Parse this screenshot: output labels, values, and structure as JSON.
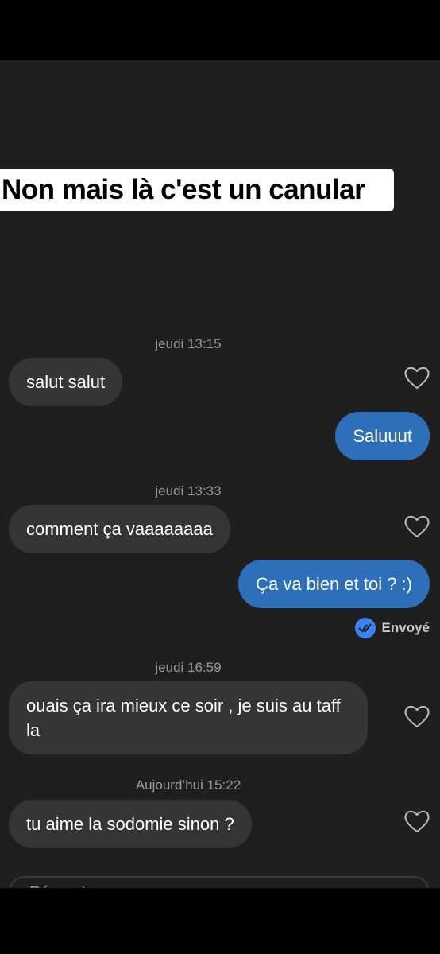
{
  "caption": "Non mais là c'est un canular",
  "messages": [
    {
      "timestamp": "jeudi 13:15"
    },
    {
      "text": "salut salut"
    },
    {
      "text": "Saluuut"
    },
    {
      "timestamp": "jeudi 13:33"
    },
    {
      "text": "comment ça vaaaaaaaa"
    },
    {
      "text": "Ça va bien et toi ? :)"
    },
    {
      "timestamp": "jeudi 16:59"
    },
    {
      "text": "ouais ça ira mieux ce soir , je suis au taff la"
    },
    {
      "timestamp": "Aujourd’hui 15:22"
    },
    {
      "text": "tu aime la sodomie sinon ?"
    }
  ],
  "status": "Envoyé",
  "reply_placeholder": "Répondre",
  "colors": {
    "incoming": "#353535",
    "outgoing": "#2e6fba",
    "background": "#1f1f1f"
  }
}
